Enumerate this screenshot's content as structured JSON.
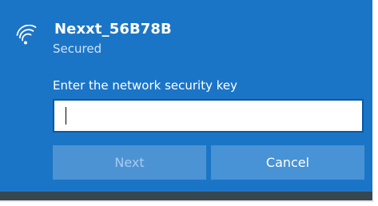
{
  "network": {
    "ssid": "Nexxt_56B78B",
    "status": "Secured",
    "icon": "wifi-secured-icon"
  },
  "security_key": {
    "prompt": "Enter the network security key",
    "value": "",
    "placeholder": ""
  },
  "buttons": {
    "next_label": "Next",
    "next_enabled": false,
    "cancel_label": "Cancel"
  },
  "colors": {
    "panel_bg": "#1b75c7",
    "button_bg": "#4892d6",
    "disabled_text": "#a9cbea",
    "status_text": "#cfe3f5"
  }
}
